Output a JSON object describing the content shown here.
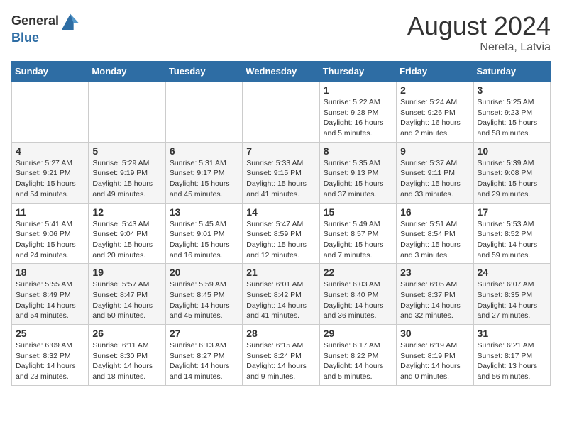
{
  "header": {
    "logo_general": "General",
    "logo_blue": "Blue",
    "month_year": "August 2024",
    "location": "Nereta, Latvia"
  },
  "weekdays": [
    "Sunday",
    "Monday",
    "Tuesday",
    "Wednesday",
    "Thursday",
    "Friday",
    "Saturday"
  ],
  "weeks": [
    [
      {
        "day": "",
        "info": ""
      },
      {
        "day": "",
        "info": ""
      },
      {
        "day": "",
        "info": ""
      },
      {
        "day": "",
        "info": ""
      },
      {
        "day": "1",
        "info": "Sunrise: 5:22 AM\nSunset: 9:28 PM\nDaylight: 16 hours\nand 5 minutes."
      },
      {
        "day": "2",
        "info": "Sunrise: 5:24 AM\nSunset: 9:26 PM\nDaylight: 16 hours\nand 2 minutes."
      },
      {
        "day": "3",
        "info": "Sunrise: 5:25 AM\nSunset: 9:23 PM\nDaylight: 15 hours\nand 58 minutes."
      }
    ],
    [
      {
        "day": "4",
        "info": "Sunrise: 5:27 AM\nSunset: 9:21 PM\nDaylight: 15 hours\nand 54 minutes."
      },
      {
        "day": "5",
        "info": "Sunrise: 5:29 AM\nSunset: 9:19 PM\nDaylight: 15 hours\nand 49 minutes."
      },
      {
        "day": "6",
        "info": "Sunrise: 5:31 AM\nSunset: 9:17 PM\nDaylight: 15 hours\nand 45 minutes."
      },
      {
        "day": "7",
        "info": "Sunrise: 5:33 AM\nSunset: 9:15 PM\nDaylight: 15 hours\nand 41 minutes."
      },
      {
        "day": "8",
        "info": "Sunrise: 5:35 AM\nSunset: 9:13 PM\nDaylight: 15 hours\nand 37 minutes."
      },
      {
        "day": "9",
        "info": "Sunrise: 5:37 AM\nSunset: 9:11 PM\nDaylight: 15 hours\nand 33 minutes."
      },
      {
        "day": "10",
        "info": "Sunrise: 5:39 AM\nSunset: 9:08 PM\nDaylight: 15 hours\nand 29 minutes."
      }
    ],
    [
      {
        "day": "11",
        "info": "Sunrise: 5:41 AM\nSunset: 9:06 PM\nDaylight: 15 hours\nand 24 minutes."
      },
      {
        "day": "12",
        "info": "Sunrise: 5:43 AM\nSunset: 9:04 PM\nDaylight: 15 hours\nand 20 minutes."
      },
      {
        "day": "13",
        "info": "Sunrise: 5:45 AM\nSunset: 9:01 PM\nDaylight: 15 hours\nand 16 minutes."
      },
      {
        "day": "14",
        "info": "Sunrise: 5:47 AM\nSunset: 8:59 PM\nDaylight: 15 hours\nand 12 minutes."
      },
      {
        "day": "15",
        "info": "Sunrise: 5:49 AM\nSunset: 8:57 PM\nDaylight: 15 hours\nand 7 minutes."
      },
      {
        "day": "16",
        "info": "Sunrise: 5:51 AM\nSunset: 8:54 PM\nDaylight: 15 hours\nand 3 minutes."
      },
      {
        "day": "17",
        "info": "Sunrise: 5:53 AM\nSunset: 8:52 PM\nDaylight: 14 hours\nand 59 minutes."
      }
    ],
    [
      {
        "day": "18",
        "info": "Sunrise: 5:55 AM\nSunset: 8:49 PM\nDaylight: 14 hours\nand 54 minutes."
      },
      {
        "day": "19",
        "info": "Sunrise: 5:57 AM\nSunset: 8:47 PM\nDaylight: 14 hours\nand 50 minutes."
      },
      {
        "day": "20",
        "info": "Sunrise: 5:59 AM\nSunset: 8:45 PM\nDaylight: 14 hours\nand 45 minutes."
      },
      {
        "day": "21",
        "info": "Sunrise: 6:01 AM\nSunset: 8:42 PM\nDaylight: 14 hours\nand 41 minutes."
      },
      {
        "day": "22",
        "info": "Sunrise: 6:03 AM\nSunset: 8:40 PM\nDaylight: 14 hours\nand 36 minutes."
      },
      {
        "day": "23",
        "info": "Sunrise: 6:05 AM\nSunset: 8:37 PM\nDaylight: 14 hours\nand 32 minutes."
      },
      {
        "day": "24",
        "info": "Sunrise: 6:07 AM\nSunset: 8:35 PM\nDaylight: 14 hours\nand 27 minutes."
      }
    ],
    [
      {
        "day": "25",
        "info": "Sunrise: 6:09 AM\nSunset: 8:32 PM\nDaylight: 14 hours\nand 23 minutes."
      },
      {
        "day": "26",
        "info": "Sunrise: 6:11 AM\nSunset: 8:30 PM\nDaylight: 14 hours\nand 18 minutes."
      },
      {
        "day": "27",
        "info": "Sunrise: 6:13 AM\nSunset: 8:27 PM\nDaylight: 14 hours\nand 14 minutes."
      },
      {
        "day": "28",
        "info": "Sunrise: 6:15 AM\nSunset: 8:24 PM\nDaylight: 14 hours\nand 9 minutes."
      },
      {
        "day": "29",
        "info": "Sunrise: 6:17 AM\nSunset: 8:22 PM\nDaylight: 14 hours\nand 5 minutes."
      },
      {
        "day": "30",
        "info": "Sunrise: 6:19 AM\nSunset: 8:19 PM\nDaylight: 14 hours\nand 0 minutes."
      },
      {
        "day": "31",
        "info": "Sunrise: 6:21 AM\nSunset: 8:17 PM\nDaylight: 13 hours\nand 56 minutes."
      }
    ]
  ]
}
